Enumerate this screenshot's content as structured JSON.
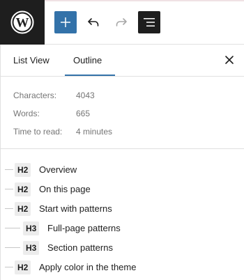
{
  "toolbar": {
    "logo_icon": "wordpress-logo",
    "add_icon": "plus-icon",
    "undo_icon": "undo-icon",
    "redo_icon": "redo-icon",
    "document_overview_icon": "list-view-icon",
    "accent_color": "#3372a9"
  },
  "panel": {
    "tabs": [
      {
        "label": "List View",
        "active": false
      },
      {
        "label": "Outline",
        "active": true
      }
    ],
    "close_icon": "close-icon",
    "stats": [
      {
        "label": "Characters:",
        "value": "4043"
      },
      {
        "label": "Words:",
        "value": "665"
      },
      {
        "label": "Time to read:",
        "value": "4 minutes"
      }
    ],
    "outline": [
      {
        "level": "H2",
        "text": "Overview"
      },
      {
        "level": "H2",
        "text": "On this page"
      },
      {
        "level": "H2",
        "text": "Start with patterns"
      },
      {
        "level": "H3",
        "text": "Full-page patterns"
      },
      {
        "level": "H3",
        "text": "Section patterns"
      },
      {
        "level": "H2",
        "text": "Apply color in the theme"
      }
    ]
  }
}
